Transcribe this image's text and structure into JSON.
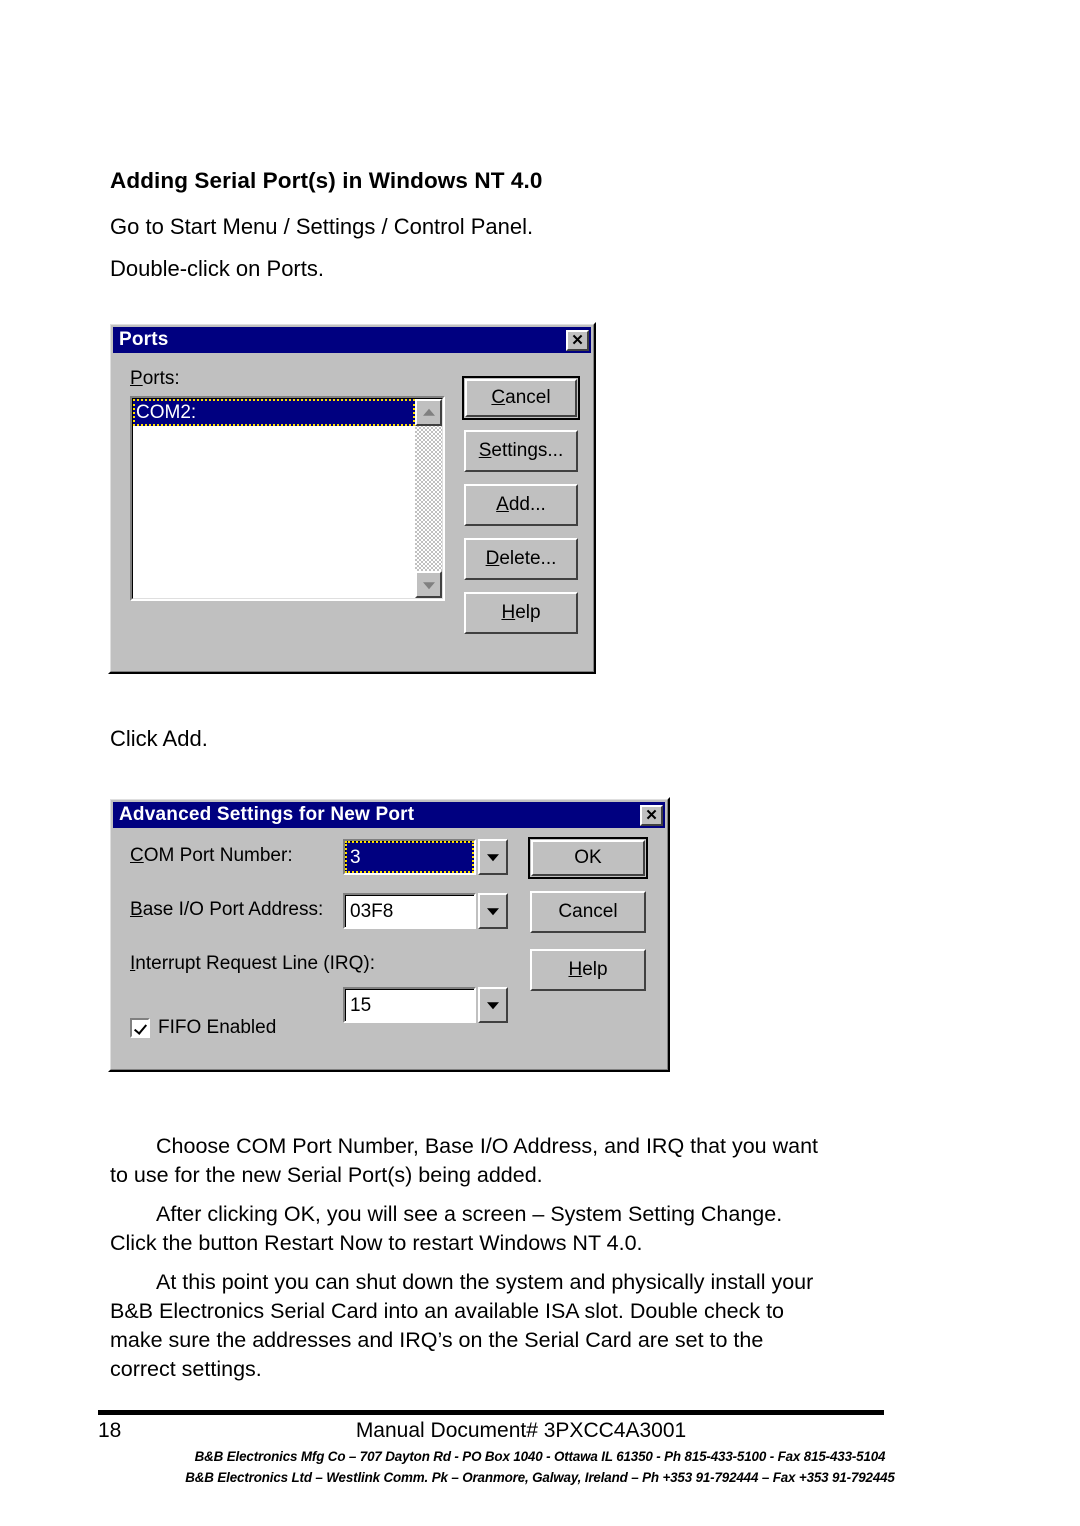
{
  "document": {
    "heading": "Adding Serial Port(s) in Windows NT 4.0",
    "line1": "Go to Start Menu / Settings / Control Panel.",
    "line2": "Double-click on Ports.",
    "click_add": "Click Add.",
    "paragraph1": "Choose COM Port Number, Base I/O Address, and IRQ that you want to use for the new Serial Port(s) being added.",
    "paragraph2": "After clicking OK, you will see a screen – System Setting Change. Click the button Restart Now to restart Windows NT 4.0.",
    "paragraph3": "At this point you can shut down the system and physically install your B&B Electronics Serial Card into an available ISA slot. Double check to make sure the addresses and IRQ’s on the Serial Card are set to the correct settings."
  },
  "ports_dialog": {
    "title": "Ports",
    "close_glyph": "✕",
    "list_label_prefix": "P",
    "list_label_rest": "orts:",
    "list_items": [
      "COM2:"
    ],
    "buttons": [
      {
        "id": "cancel",
        "prefix": "",
        "accel": "C",
        "rest": "ancel",
        "default": true
      },
      {
        "id": "settings",
        "prefix": "",
        "accel": "S",
        "rest": "ettings...",
        "default": false
      },
      {
        "id": "add",
        "prefix": "",
        "accel": "A",
        "rest": "dd...",
        "default": false
      },
      {
        "id": "delete",
        "prefix": "",
        "accel": "D",
        "rest": "elete...",
        "default": false
      },
      {
        "id": "help",
        "prefix": "",
        "accel": "H",
        "rest": "elp",
        "default": false
      }
    ]
  },
  "advanced_dialog": {
    "title": "Advanced Settings for New Port",
    "close_glyph": "✕",
    "fields": [
      {
        "id": "com-port-number",
        "accel": "C",
        "rest": "OM Port Number:",
        "value": "3"
      },
      {
        "id": "base-io-address",
        "accel": "B",
        "rest": "ase I/O Port Address:",
        "value": "03F8"
      },
      {
        "id": "irq",
        "accel": "I",
        "rest": "nterrupt Request Line (IRQ):",
        "value": "15"
      }
    ],
    "checkbox": {
      "accel": "F",
      "rest": "IFO Enabled",
      "checked": true
    },
    "buttons": [
      {
        "id": "ok",
        "accel": "",
        "rest": "OK",
        "default": true
      },
      {
        "id": "cancel",
        "accel": "",
        "rest": "Cancel",
        "default": false
      },
      {
        "id": "help",
        "accel": "H",
        "rest": "elp",
        "default": false
      }
    ]
  },
  "footer": {
    "page_number": "18",
    "document_id": "Manual Document# 3PXCC4A3001",
    "address_line1": "B&B Electronics Mfg Co – 707 Dayton Rd - PO Box 1040 - Ottawa IL 61350 - Ph 815-433-5100 - Fax 815-433-5104",
    "address_line2": "B&B Electronics Ltd – Westlink Comm. Pk – Oranmore, Galway, Ireland – Ph +353 91-792444 – Fax +353 91-792445"
  },
  "colors": {
    "titlebar": "#000080",
    "dialog_face": "#c0c0c0",
    "selection": "#000080",
    "focus_outline": "#ffe000"
  }
}
